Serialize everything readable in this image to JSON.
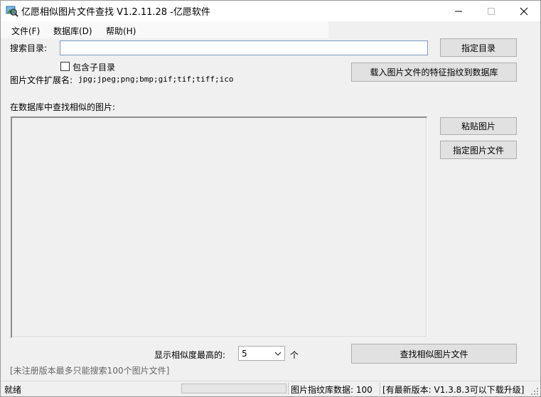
{
  "window": {
    "title": "亿愿相似图片文件查找 V1.2.11.28 -亿愿软件"
  },
  "menu": {
    "items": [
      "文件(F)",
      "数据库(D)",
      "帮助(H)"
    ]
  },
  "search": {
    "dir_label": "搜索目录:",
    "dir_value": "",
    "dir_button": "指定目录",
    "include_sub_label": "包含子目录",
    "include_sub_checked": false,
    "ext_label": "图片文件扩展名:",
    "ext_value": "jpg;jpeg;png;bmp;gif;tif;tiff;ico",
    "load_button": "载入图片文件的特征指纹到数据库"
  },
  "find": {
    "section_label": "在数据库中查找相似的图片:",
    "paste_button": "粘贴图片",
    "choose_button": "指定图片文件",
    "show_label": "显示相似度最高的:",
    "count_value": "5",
    "count_unit": "个",
    "find_button": "查找相似图片文件",
    "notice": "[未注册版本最多只能搜索100个图片文件]"
  },
  "status": {
    "state": "就绪",
    "progress": 0,
    "db_count": "图片指纹库数据: 100",
    "update": "[有最新版本: V1.3.8.3可以下载升级]"
  }
}
